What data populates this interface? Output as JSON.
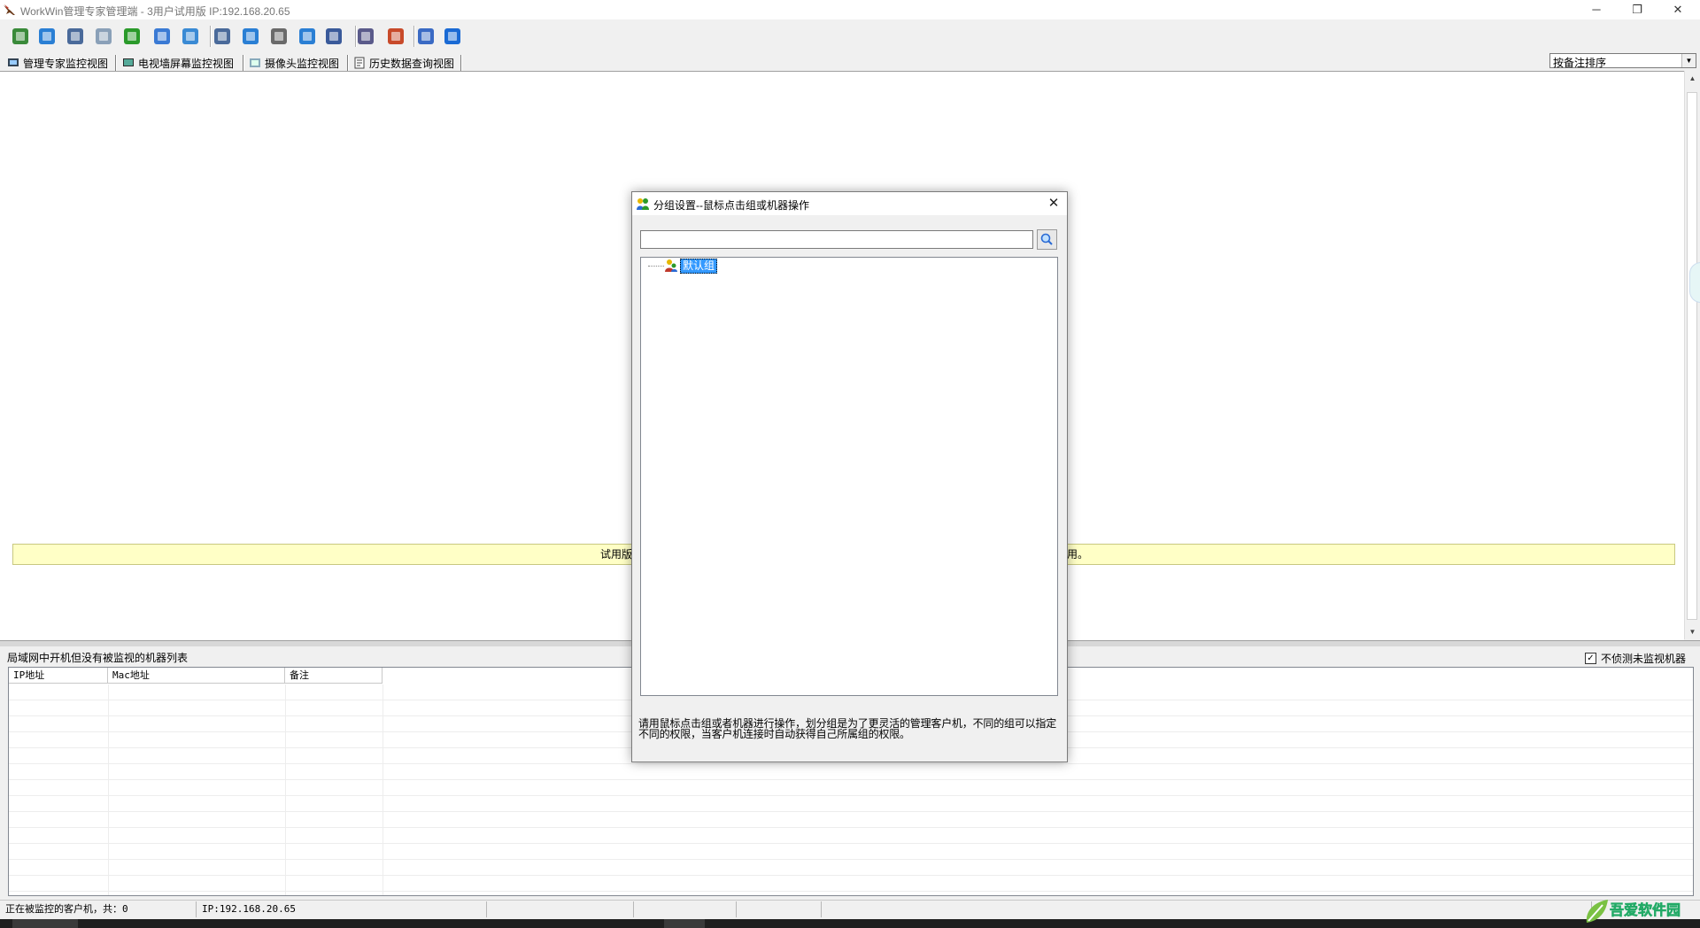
{
  "window": {
    "title": "WorkWin管理专家管理端 - 3用户试用版 IP:192.168.20.65",
    "minimize": "─",
    "restore": "❐",
    "close": "✕"
  },
  "toolbar": {
    "buttons": [
      {
        "icon": "database-icon",
        "color": "#3a8a3a"
      },
      {
        "icon": "globe-icon",
        "color": "#2a7fd4"
      },
      {
        "icon": "monitor-settings-icon",
        "color": "#4a6a9a"
      },
      {
        "icon": "mail-icon",
        "color": "#8aa0b8"
      },
      {
        "icon": "users-icon",
        "color": "#2a9a2a"
      },
      {
        "icon": "network-icon",
        "color": "#3a7ad4"
      },
      {
        "icon": "usb-icon",
        "color": "#3a8ad4"
      },
      {
        "icon": "screen-icon",
        "color": "#4a6a9a"
      },
      {
        "icon": "remote-icon",
        "color": "#2a7fd4"
      },
      {
        "icon": "document-search-icon",
        "color": "#6a6a6a"
      },
      {
        "icon": "copy-icon",
        "color": "#2a7fd4"
      },
      {
        "icon": "disk-icon",
        "color": "#3a5a9a"
      },
      {
        "icon": "book-icon",
        "color": "#5a5a8a"
      },
      {
        "icon": "report-icon",
        "color": "#c84a2a"
      },
      {
        "icon": "shop-icon",
        "color": "#3a6ac4"
      },
      {
        "icon": "help-icon",
        "color": "#1a6ad4"
      }
    ]
  },
  "tabs": [
    {
      "label": "管理专家监控视图",
      "icon": "monitor-view-icon"
    },
    {
      "label": "电视墙屏幕监控视图",
      "icon": "tv-wall-icon"
    },
    {
      "label": "摄像头监控视图",
      "icon": "camera-icon"
    },
    {
      "label": "历史数据查询视图",
      "icon": "history-icon"
    }
  ],
  "sort": {
    "selected": "按备注排序"
  },
  "trial_notice_left": "试用版",
  "trial_notice_right": "用。",
  "bottom_panel": {
    "title": "局域网中开机但没有被监视的机器列表",
    "checkbox_label": "不侦测未监视机器",
    "checkbox_checked": "✓",
    "columns": [
      "IP地址",
      "Mac地址",
      "备注"
    ]
  },
  "status": {
    "cells": [
      "正在被监控的客户机，共：0",
      "IP:192.168.20.65",
      "",
      "",
      "",
      ""
    ]
  },
  "dialog": {
    "title": "分组设置--鼠标点击组或机器操作",
    "search_value": "",
    "tree_items": [
      {
        "label": "默认组",
        "selected": true
      }
    ],
    "hint": "请用鼠标点击组或者机器进行操作，划分组是为了更灵活的管理客户机，不同的组可以指定不同的权限，当客户机连接时自动获得自己所属组的权限。"
  },
  "watermark": {
    "text": "吾爱软件园"
  },
  "colors": {
    "accent": "#3399ff",
    "trial_bg": "#ffffc6",
    "taskbar": "#1f1f1f"
  }
}
